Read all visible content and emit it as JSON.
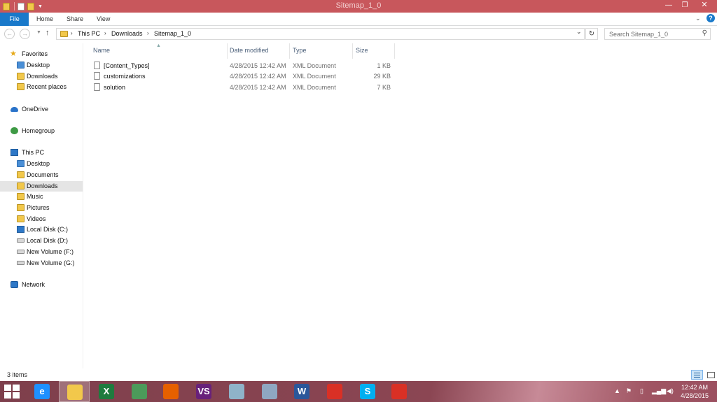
{
  "window": {
    "title": "Sitemap_1_0",
    "minimize_glyph": "—",
    "maximize_glyph": "❐",
    "close_glyph": "✕"
  },
  "ribbon": {
    "tabs": [
      {
        "label": "File"
      },
      {
        "label": "Home"
      },
      {
        "label": "Share"
      },
      {
        "label": "View"
      }
    ],
    "help_glyph": "?"
  },
  "address": {
    "breadcrumb": [
      "This PC",
      "Downloads",
      "Sitemap_1_0"
    ],
    "search_placeholder": "Search Sitemap_1_0"
  },
  "nav": {
    "favorites_label": "Favorites",
    "favorites": [
      {
        "label": "Desktop"
      },
      {
        "label": "Downloads"
      },
      {
        "label": "Recent places"
      }
    ],
    "onedrive_label": "OneDrive",
    "homegroup_label": "Homegroup",
    "thispc_label": "This PC",
    "thispc": [
      {
        "label": "Desktop"
      },
      {
        "label": "Documents"
      },
      {
        "label": "Downloads"
      },
      {
        "label": "Music"
      },
      {
        "label": "Pictures"
      },
      {
        "label": "Videos"
      },
      {
        "label": "Local Disk (C:)"
      },
      {
        "label": "Local Disk (D:)"
      },
      {
        "label": "New Volume (F:)"
      },
      {
        "label": "New Volume (G:)"
      }
    ],
    "network_label": "Network",
    "selected": "Downloads"
  },
  "filelist": {
    "columns": [
      "Name",
      "Date modified",
      "Type",
      "Size"
    ],
    "rows": [
      {
        "name": "[Content_Types]",
        "date": "4/28/2015 12:42 AM",
        "type": "XML Document",
        "size": "1 KB"
      },
      {
        "name": "customizations",
        "date": "4/28/2015 12:42 AM",
        "type": "XML Document",
        "size": "29 KB"
      },
      {
        "name": "solution",
        "date": "4/28/2015 12:42 AM",
        "type": "XML Document",
        "size": "7 KB"
      }
    ]
  },
  "status": {
    "item_count": "3 items"
  },
  "taskbar": {
    "apps": [
      {
        "icon": "internet-explorer-icon",
        "glyph": "e",
        "color": "#1e90ff"
      },
      {
        "icon": "file-explorer-icon",
        "glyph": "",
        "color": "#f2c84b"
      },
      {
        "icon": "excel-icon",
        "glyph": "X",
        "color": "#1e7b3e"
      },
      {
        "icon": "app-icon",
        "glyph": "",
        "color": "#4c9a5a"
      },
      {
        "icon": "firefox-icon",
        "glyph": "",
        "color": "#e66000"
      },
      {
        "icon": "visual-studio-icon",
        "glyph": "VS",
        "color": "#68217a"
      },
      {
        "icon": "app-icon-2",
        "glyph": "",
        "color": "#8fb3c9"
      },
      {
        "icon": "calculator-icon",
        "glyph": "",
        "color": "#8fa7c2"
      },
      {
        "icon": "word-icon",
        "glyph": "W",
        "color": "#2b579a"
      },
      {
        "icon": "chrome-icon",
        "glyph": "",
        "color": "#d93025"
      },
      {
        "icon": "skype-icon",
        "glyph": "S",
        "color": "#00aff0"
      },
      {
        "icon": "chrome-icon-2",
        "glyph": "",
        "color": "#d93025"
      }
    ],
    "time": "12:42 AM",
    "date": "4/28/2015"
  }
}
